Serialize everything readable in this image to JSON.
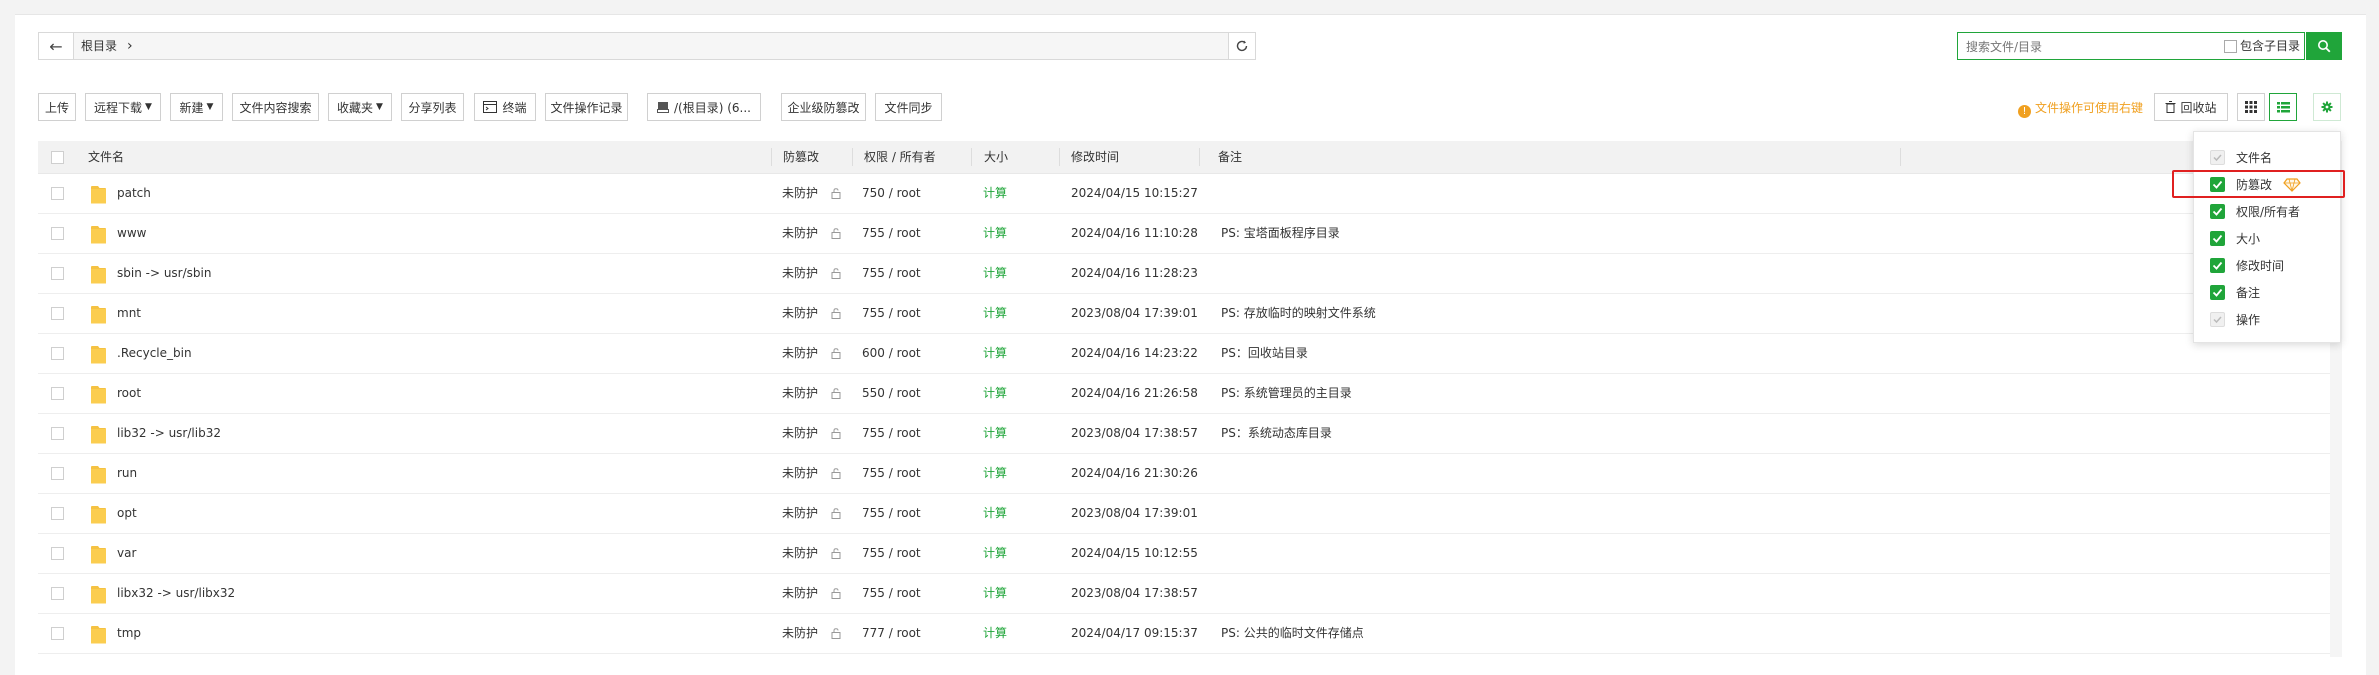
{
  "path_bar": {
    "crumb": "根目录"
  },
  "search": {
    "placeholder": "搜索文件/目录",
    "include_sub": "包含子目录"
  },
  "toolbar": {
    "upload": "上传",
    "remote_download": "远程下载",
    "new": "新建",
    "content_search": "文件内容搜索",
    "favorites": "收藏夹",
    "share_list": "分享列表",
    "terminal": "终端",
    "op_log": "文件操作记录",
    "disk": "/(根目录) (6...",
    "tamper": "企业级防篡改",
    "sync": "文件同步",
    "tip": "文件操作可使用右键",
    "recycle": "回收站"
  },
  "columns": {
    "name": "文件名",
    "tamper": "防篡改",
    "perm": "权限 / 所有者",
    "size": "大小",
    "mtime": "修改时间",
    "note": "备注"
  },
  "rows": [
    {
      "name": "patch",
      "tamper": "未防护",
      "perm": "750 / root",
      "size": "计算",
      "mtime": "2024/04/15 10:15:27",
      "note": ""
    },
    {
      "name": "www",
      "tamper": "未防护",
      "perm": "755 / root",
      "size": "计算",
      "mtime": "2024/04/16 11:10:28",
      "note": "PS: 宝塔面板程序目录"
    },
    {
      "name": "sbin -> usr/sbin",
      "tamper": "未防护",
      "perm": "755 / root",
      "size": "计算",
      "mtime": "2024/04/16 11:28:23",
      "note": ""
    },
    {
      "name": "mnt",
      "tamper": "未防护",
      "perm": "755 / root",
      "size": "计算",
      "mtime": "2023/08/04 17:39:01",
      "note": "PS: 存放临时的映射文件系统"
    },
    {
      "name": ".Recycle_bin",
      "tamper": "未防护",
      "perm": "600 / root",
      "size": "计算",
      "mtime": "2024/04/16 14:23:22",
      "note": "PS：回收站目录"
    },
    {
      "name": "root",
      "tamper": "未防护",
      "perm": "550 / root",
      "size": "计算",
      "mtime": "2024/04/16 21:26:58",
      "note": "PS: 系统管理员的主目录"
    },
    {
      "name": "lib32 -> usr/lib32",
      "tamper": "未防护",
      "perm": "755 / root",
      "size": "计算",
      "mtime": "2023/08/04 17:38:57",
      "note": "PS：系统动态库目录"
    },
    {
      "name": "run",
      "tamper": "未防护",
      "perm": "755 / root",
      "size": "计算",
      "mtime": "2024/04/16 21:30:26",
      "note": ""
    },
    {
      "name": "opt",
      "tamper": "未防护",
      "perm": "755 / root",
      "size": "计算",
      "mtime": "2023/08/04 17:39:01",
      "note": ""
    },
    {
      "name": "var",
      "tamper": "未防护",
      "perm": "755 / root",
      "size": "计算",
      "mtime": "2024/04/15 10:12:55",
      "note": ""
    },
    {
      "name": "libx32 -> usr/libx32",
      "tamper": "未防护",
      "perm": "755 / root",
      "size": "计算",
      "mtime": "2023/08/04 17:38:57",
      "note": ""
    },
    {
      "name": "tmp",
      "tamper": "未防护",
      "perm": "777 / root",
      "size": "计算",
      "mtime": "2024/04/17 09:15:37",
      "note": "PS: 公共的临时文件存储点"
    }
  ],
  "column_menu": [
    {
      "label": "文件名",
      "checked": true,
      "disabled": true
    },
    {
      "label": "防篡改",
      "checked": true,
      "disabled": false
    },
    {
      "label": "权限/所有者",
      "checked": true,
      "disabled": false
    },
    {
      "label": "大小",
      "checked": true,
      "disabled": false
    },
    {
      "label": "修改时间",
      "checked": true,
      "disabled": false
    },
    {
      "label": "备注",
      "checked": true,
      "disabled": false
    },
    {
      "label": "操作",
      "checked": true,
      "disabled": true
    }
  ],
  "colors": {
    "accent": "#20a53a",
    "warning": "#f0a020",
    "highlight": "#e02020",
    "folder": "#f5c242"
  }
}
